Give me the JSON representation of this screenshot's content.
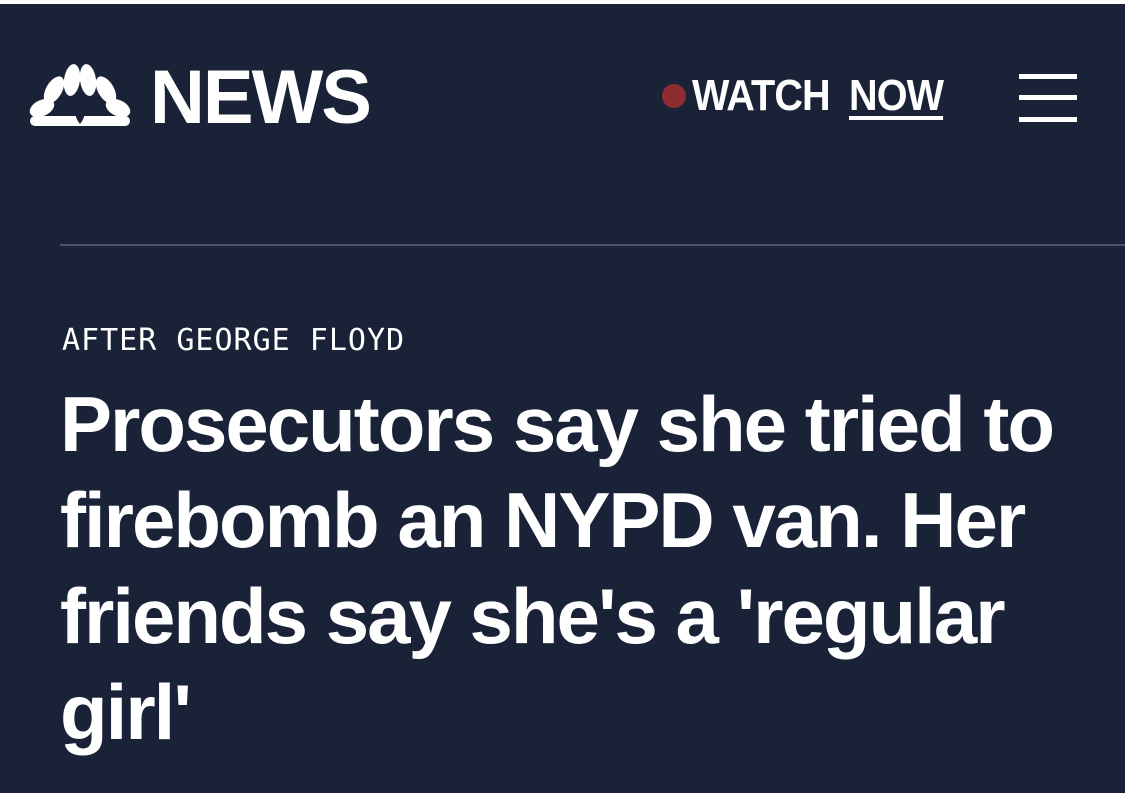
{
  "header": {
    "brand": "NEWS",
    "logo_icon": "nbc-peacock-icon",
    "watch_label": "WATCH",
    "now_label": "NOW",
    "live_dot_color": "#8e2c32",
    "menu_icon": "hamburger-menu-icon"
  },
  "article": {
    "eyebrow": "AFTER GEORGE FLOYD",
    "headline": "Prosecutors say she tried to firebomb an NYPD van. Her friends say she's a 'regular girl'"
  },
  "colors": {
    "background": "#1a2238",
    "text": "#ffffff",
    "divider": "#4a5470"
  }
}
